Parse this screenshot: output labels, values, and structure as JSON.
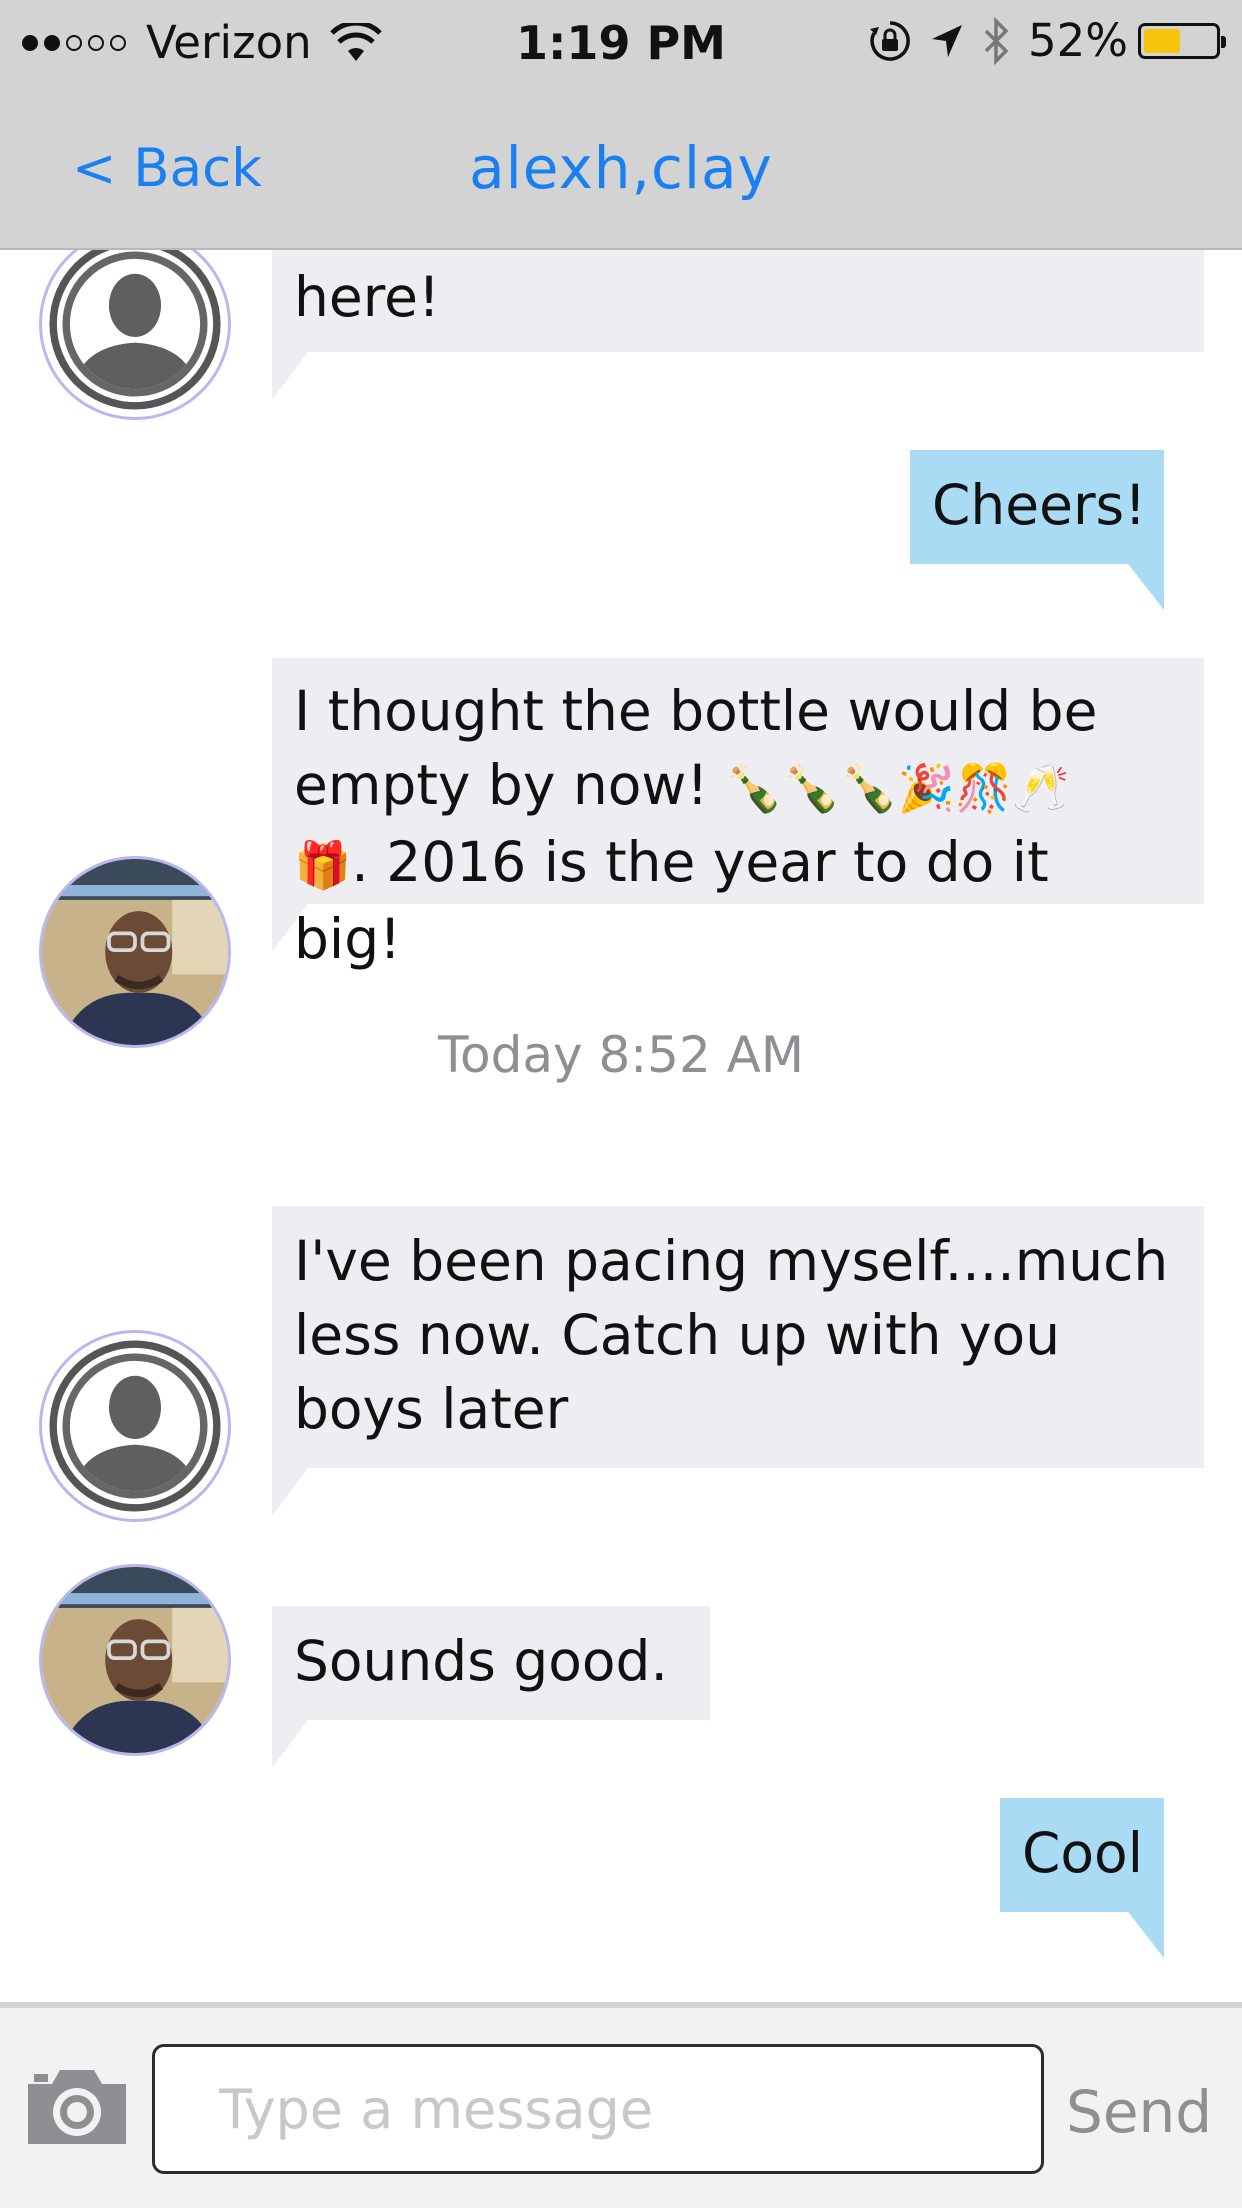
{
  "status_bar": {
    "carrier": "Verizon",
    "time": "1:19 PM",
    "battery_text": "52%",
    "battery_level": 0.52,
    "signal_bars_filled": 2,
    "signal_bars_total": 5,
    "icons": [
      "wifi-icon",
      "rotation-lock-icon",
      "location-arrow-icon",
      "bluetooth-icon",
      "battery-icon"
    ]
  },
  "nav": {
    "back_label": "< Back",
    "title": "alexh,clay"
  },
  "colors": {
    "accent": "#1a7ff0",
    "bar_bg": "#d3d3d3",
    "incoming_bubble": "#eeeef2",
    "outgoing_bubble": "#a9dcf4",
    "battery_fill": "#f5c50c",
    "avatar_ring": "#b9b7ee"
  },
  "messages": [
    {
      "id": "m1",
      "direction": "incoming",
      "avatar": "default-avatar",
      "text": "here!"
    },
    {
      "id": "m2",
      "direction": "outgoing",
      "text": "Cheers!"
    },
    {
      "id": "m3",
      "direction": "incoming",
      "avatar": "photo-avatar",
      "lines": [
        "I thought the bottle would be",
        "empty by now! ",
        ". 2016 is the year to do it",
        "big!"
      ],
      "emoji_line2": "🍾🍾🍾🎉🎊🥂",
      "emoji_line3": "🎁"
    },
    {
      "id": "ts",
      "type": "timestamp",
      "text": "Today 8:52 AM"
    },
    {
      "id": "m4",
      "direction": "incoming",
      "avatar": "default-avatar",
      "lines": [
        "I've been pacing myself....much",
        "less now. Catch up with you",
        "boys later"
      ]
    },
    {
      "id": "m5",
      "direction": "incoming",
      "avatar": "photo-avatar",
      "text": "Sounds good."
    },
    {
      "id": "m6",
      "direction": "outgoing",
      "text": "Cool"
    }
  ],
  "composer": {
    "placeholder": "Type a message",
    "value": "",
    "send_label": "Send",
    "camera_icon": "camera-icon"
  }
}
